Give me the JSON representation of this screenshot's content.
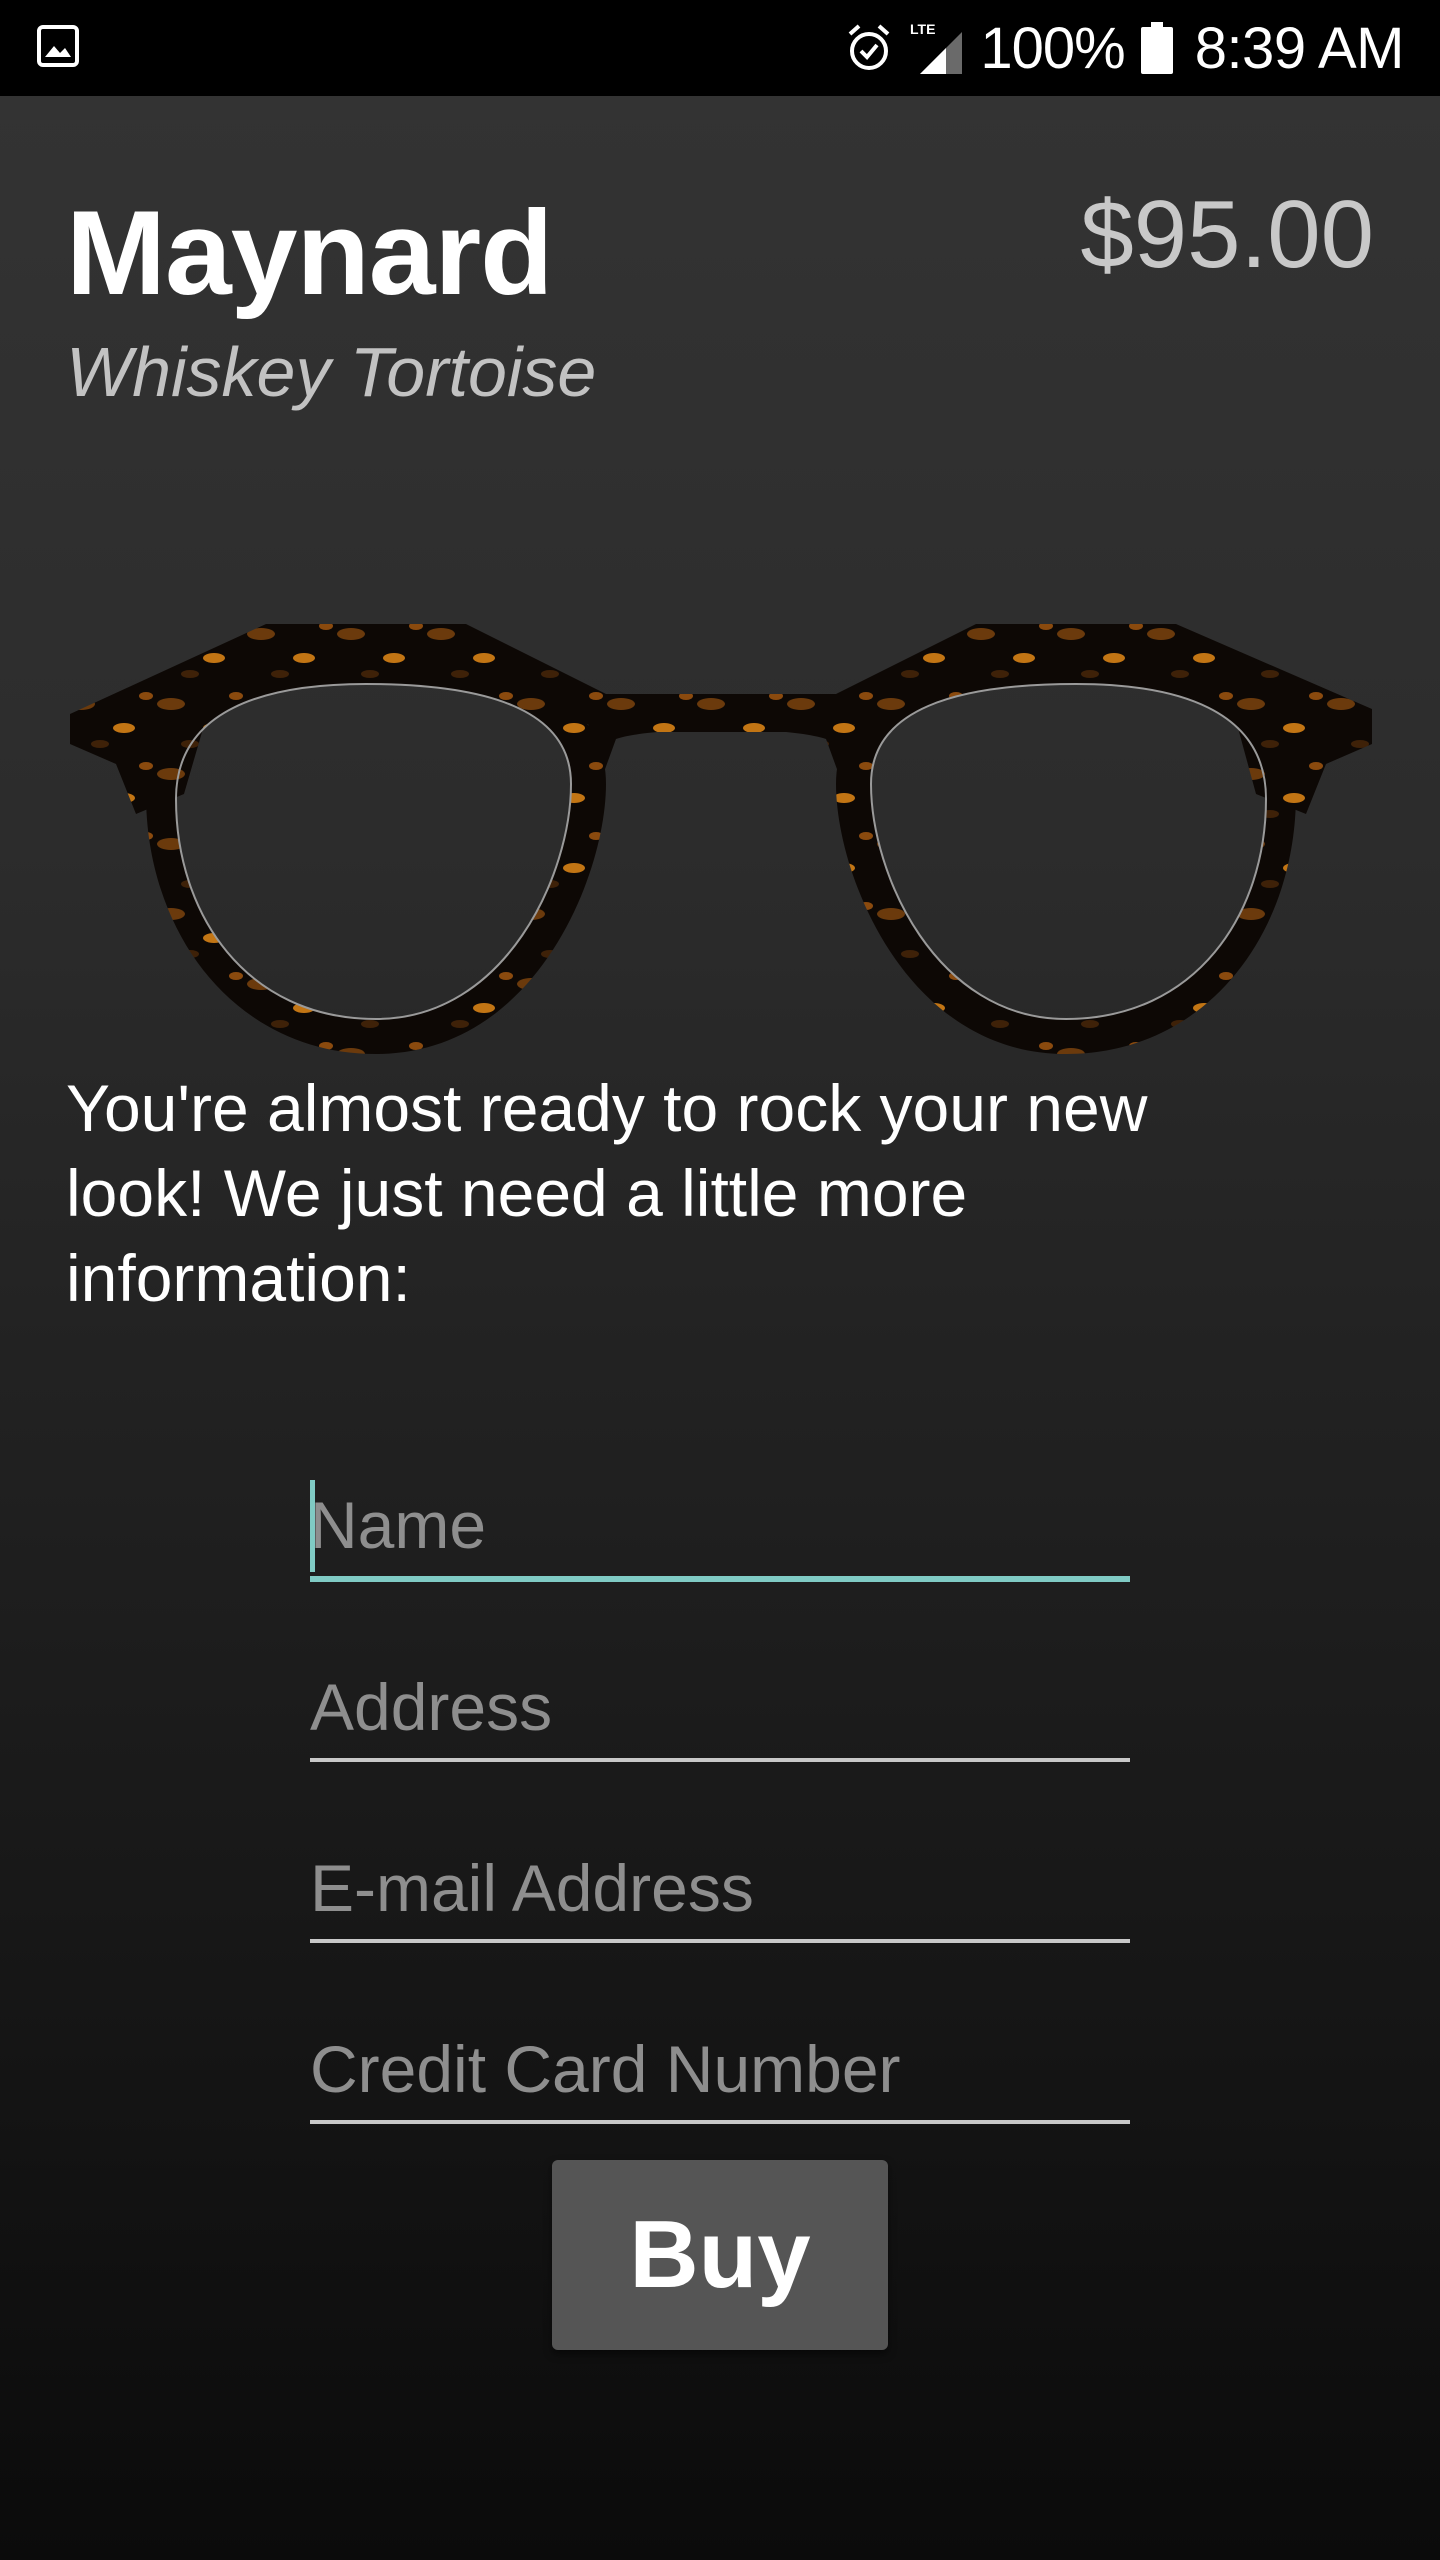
{
  "status_bar": {
    "icons": [
      "gallery-icon",
      "alarm-icon",
      "lte-signal-icon",
      "battery-icon"
    ],
    "network": "LTE",
    "battery_percent": "100%",
    "time": "8:39 AM"
  },
  "product": {
    "name": "Maynard",
    "color": "Whiskey Tortoise",
    "price": "$95.00",
    "image_icon": "eyeglasses-image"
  },
  "intro": {
    "text": "You're almost ready to rock your new look! We just need a little more information:"
  },
  "form": {
    "name_placeholder": "Name",
    "address_placeholder": "Address",
    "email_placeholder": "E-mail Address",
    "card_placeholder": "Credit Card Number",
    "buy_label": "Buy"
  },
  "colors": {
    "accent": "#80cbc4",
    "background_top": "#333333",
    "background_bottom": "#0b0b0b",
    "button": "#555555"
  }
}
